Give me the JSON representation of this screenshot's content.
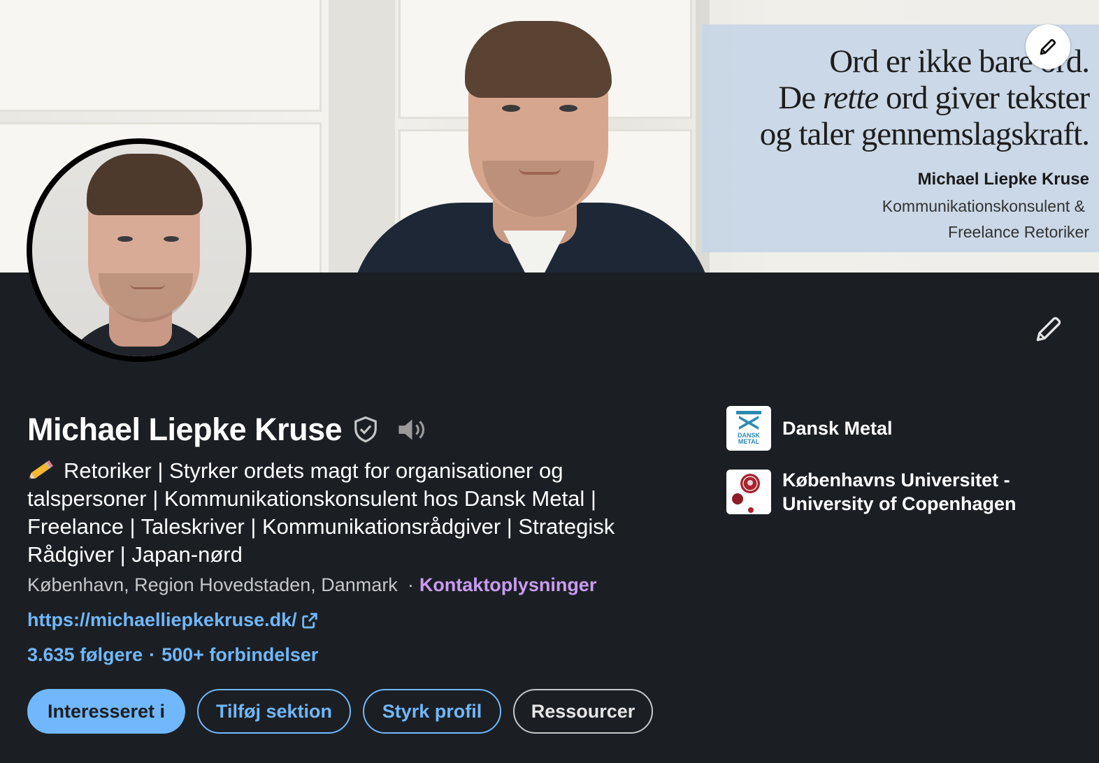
{
  "banner": {
    "quote_line1": "Ord er ikke bare ord.",
    "quote_line2_pre": "De ",
    "quote_line2_em": "rette",
    "quote_line2_post": " ord giver tekster",
    "quote_line3": "og taler gennemslagskraft.",
    "name": "Michael Liepke Kruse",
    "role_line1": "Kommunikationskonsulent &",
    "role_line2": "Freelance Retoriker"
  },
  "profile": {
    "name": "Michael Liepke Kruse",
    "headline": "Retoriker | Styrker ordets magt for organisationer og talspersoner | Kommunikationskonsulent hos Dansk Metal | Freelance | Taleskriver | Kommunikationsrådgiver | Strategisk Rådgiver | Japan-nørd",
    "location": "København, Region Hovedstaden, Danmark",
    "location_sep": "·",
    "contact_label": "Kontaktoplysninger",
    "website": "https://michaelliepkekruse.dk/",
    "followers": "3.635 følgere",
    "stats_sep": "·",
    "connections": "500+ forbindelser"
  },
  "actions": {
    "interested": "Interesseret i",
    "add_section": "Tilføj sektion",
    "strengthen": "Styrk profil",
    "resources": "Ressourcer"
  },
  "organizations": [
    {
      "name": "Dansk Metal",
      "logo_text_1": "DANSK",
      "logo_text_2": "METAL"
    },
    {
      "name_line1": "Københavns Universitet -",
      "name_line2": "University of Copenhagen"
    }
  ],
  "icons": {
    "banner_edit": "pencil-icon",
    "profile_edit": "pencil-icon",
    "verified": "shield-check-icon",
    "pronunciation": "speaker-icon",
    "external_link": "external-link-icon",
    "headline_emoji": "pencil-emoji-icon"
  },
  "colors": {
    "background": "#1b1f23",
    "link_blue": "#71b7fb",
    "contact_purple": "#c99cf2",
    "muted_text": "#c7c7c7",
    "quote_box": "#c7d6e6"
  }
}
